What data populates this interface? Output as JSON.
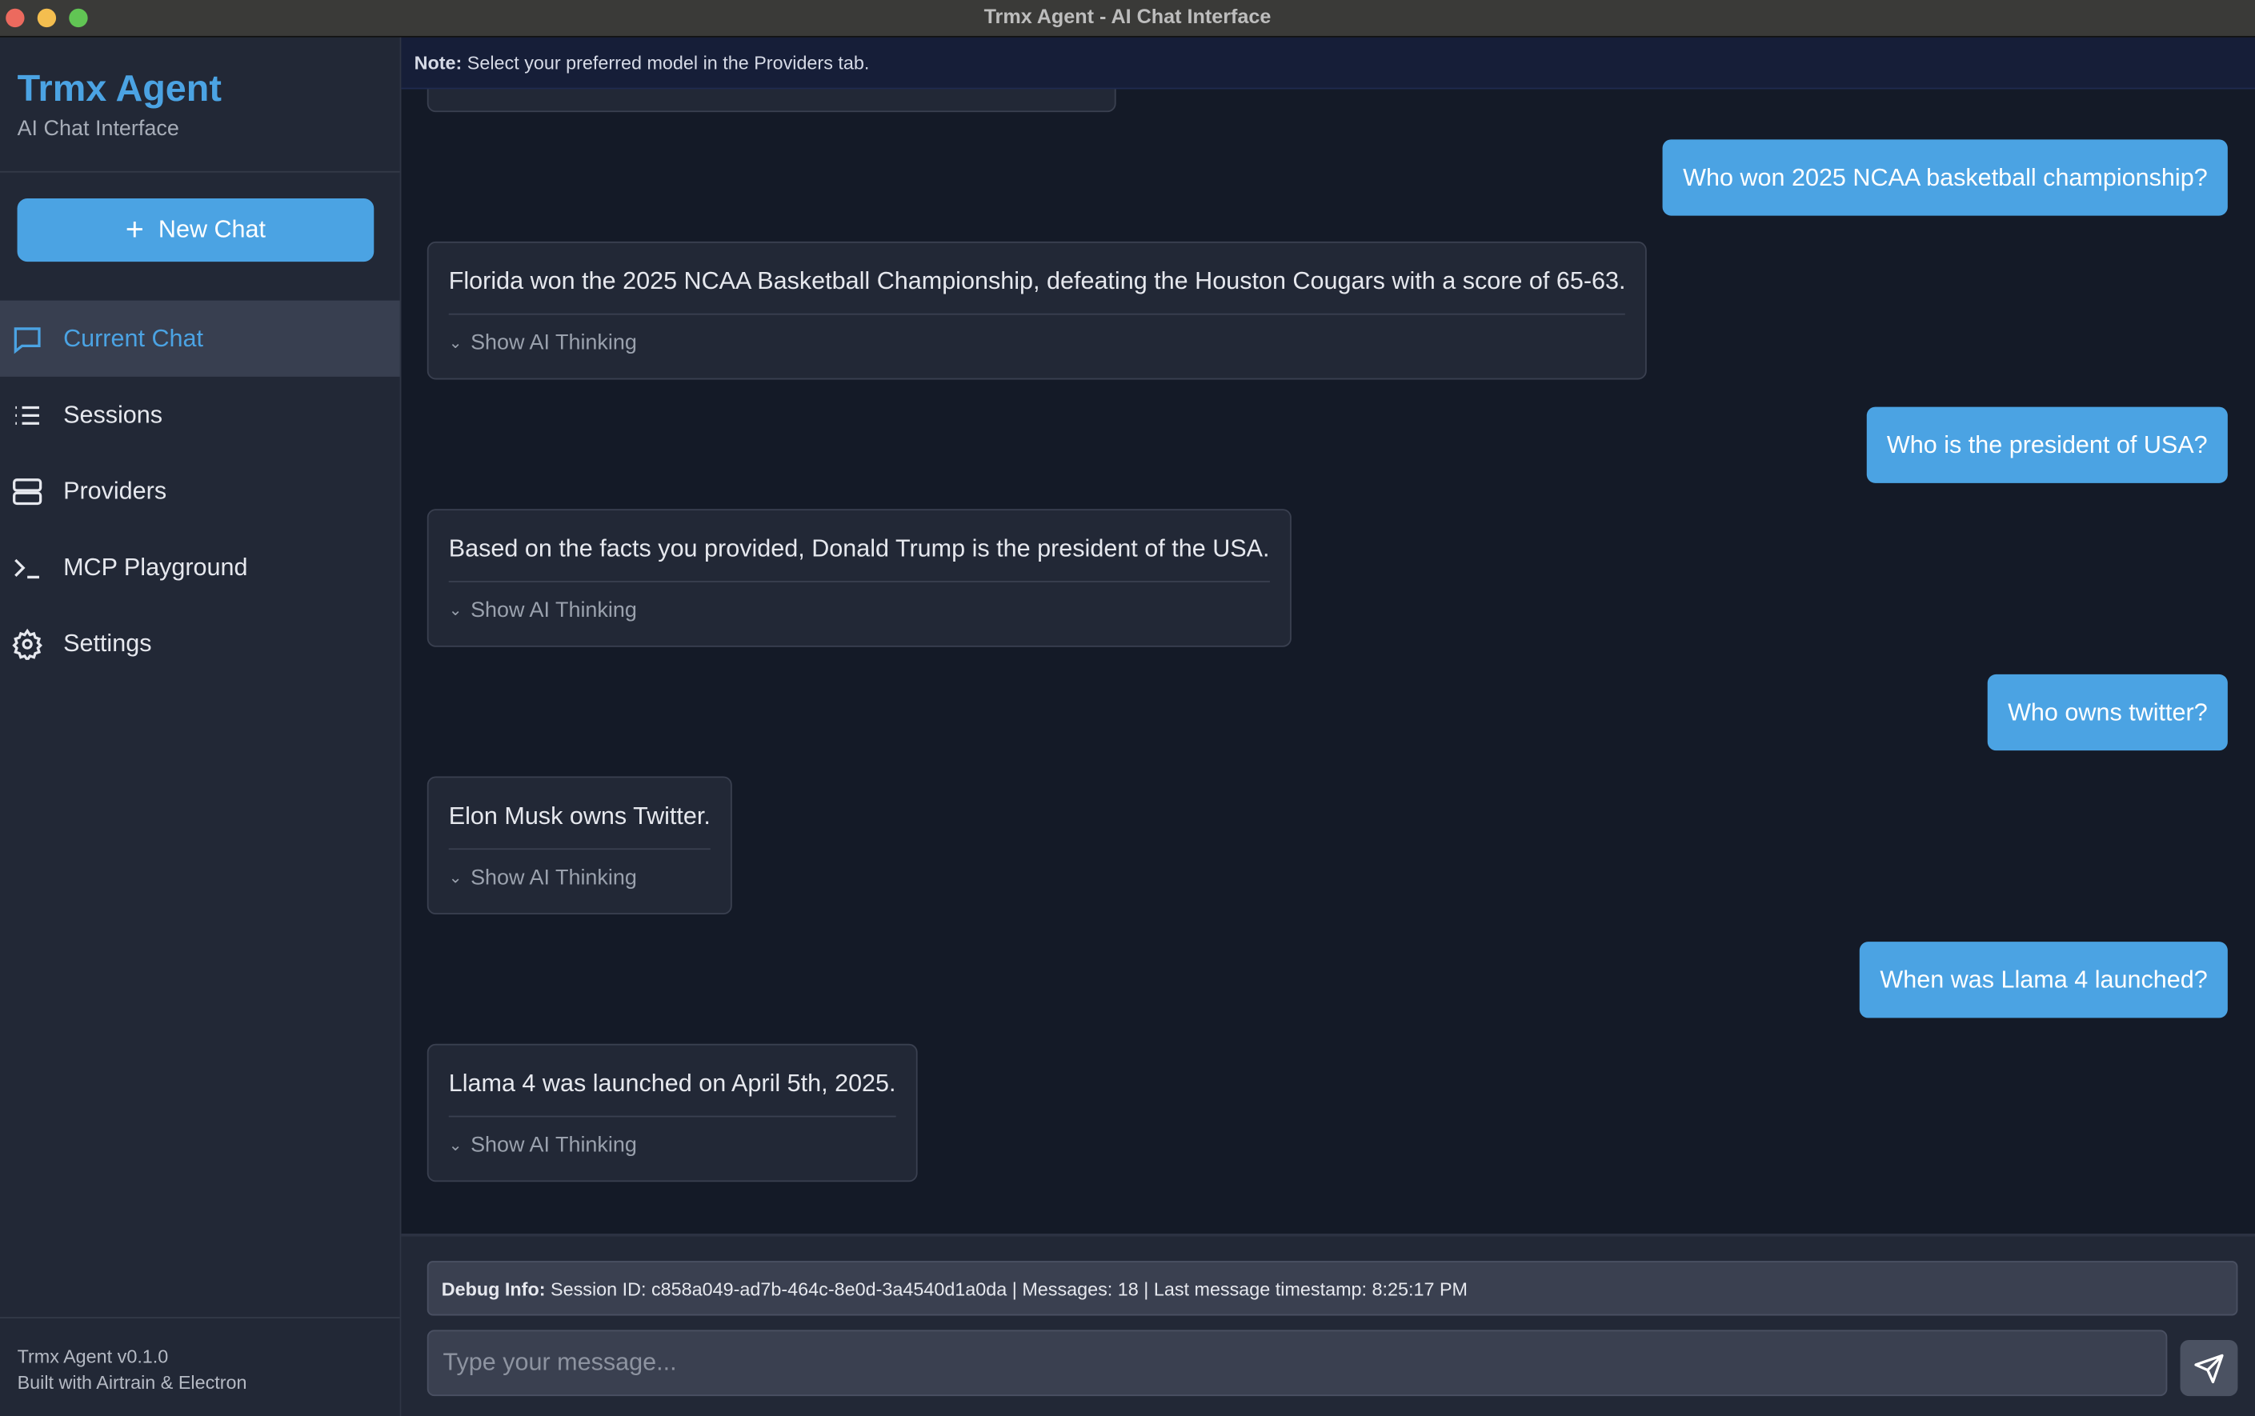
{
  "window": {
    "title": "Trmx Agent - AI Chat Interface"
  },
  "sidebar": {
    "brand": "Trmx Agent",
    "subtitle": "AI Chat Interface",
    "new_chat": "New Chat",
    "items": [
      {
        "label": "Current Chat",
        "icon": "chat-bubble-icon",
        "active": true
      },
      {
        "label": "Sessions",
        "icon": "list-icon"
      },
      {
        "label": "Providers",
        "icon": "server-icon"
      },
      {
        "label": "MCP Playground",
        "icon": "terminal-icon"
      },
      {
        "label": "Settings",
        "icon": "gear-icon"
      }
    ],
    "footer": {
      "version": "Trmx Agent v0.1.0",
      "built": "Built with Airtrain & Electron"
    }
  },
  "note": {
    "label": "Note:",
    "text": " Select your preferred model in the Providers tab."
  },
  "messages": [
    {
      "role": "user",
      "text": "Who won 2025 NCAA basketball championship?"
    },
    {
      "role": "assistant",
      "text": "Florida won the 2025 NCAA Basketball Championship, defeating the Houston Cougars with a score of 65-63.",
      "thinking": "Show AI Thinking"
    },
    {
      "role": "user",
      "text": "Who is the president of USA?"
    },
    {
      "role": "assistant",
      "text": "Based on the facts you provided, Donald Trump is the president of the USA.",
      "thinking": "Show AI Thinking"
    },
    {
      "role": "user",
      "text": "Who owns twitter?"
    },
    {
      "role": "assistant",
      "text": "Elon Musk owns Twitter.",
      "thinking": "Show AI Thinking"
    },
    {
      "role": "user",
      "text": "When was Llama 4 launched?"
    },
    {
      "role": "assistant",
      "text": "Llama 4 was launched on April 5th, 2025.",
      "thinking": "Show AI Thinking"
    }
  ],
  "debug": {
    "label": "Debug Info:",
    "text": " Session ID: c858a049-ad7b-464c-8e0d-3a4540d1a0da | Messages: 18 | Last message timestamp: 8:25:17 PM"
  },
  "composer": {
    "placeholder": "Type your message...",
    "value": ""
  },
  "colors": {
    "accent": "#4ba3e3",
    "sidebar": "#222836",
    "main": "#141a27"
  }
}
